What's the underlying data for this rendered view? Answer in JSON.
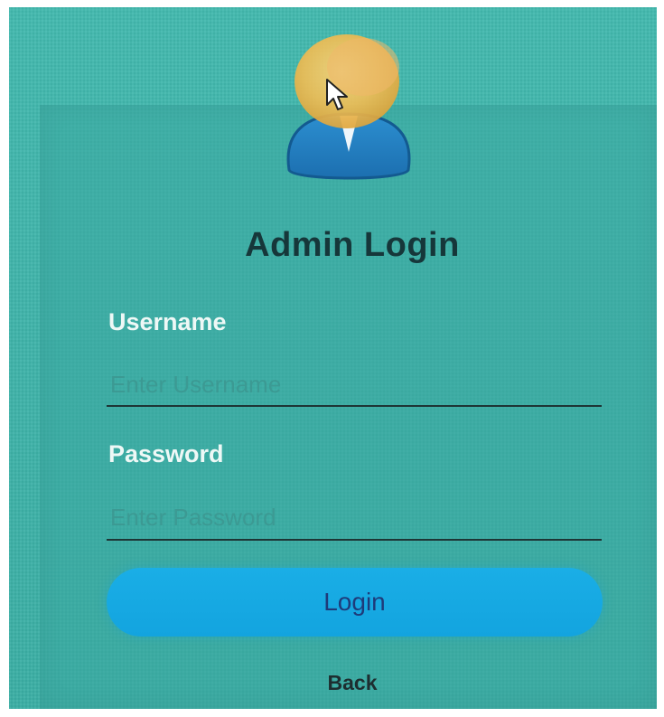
{
  "login_form": {
    "title": "Admin Login",
    "username_label": "Username",
    "username_placeholder": "Enter Username",
    "password_label": "Password",
    "password_placeholder": "Enter Password",
    "login_button": "Login",
    "back_link": "Back"
  },
  "icons": {
    "avatar": "user-avatar-icon",
    "cursor": "mouse-cursor-icon"
  },
  "colors": {
    "background": "#3fb4aa",
    "title_text": "#16373a",
    "label_text": "#eef8f6",
    "button": "#13a4df",
    "button_text": "#1e3b7a"
  }
}
